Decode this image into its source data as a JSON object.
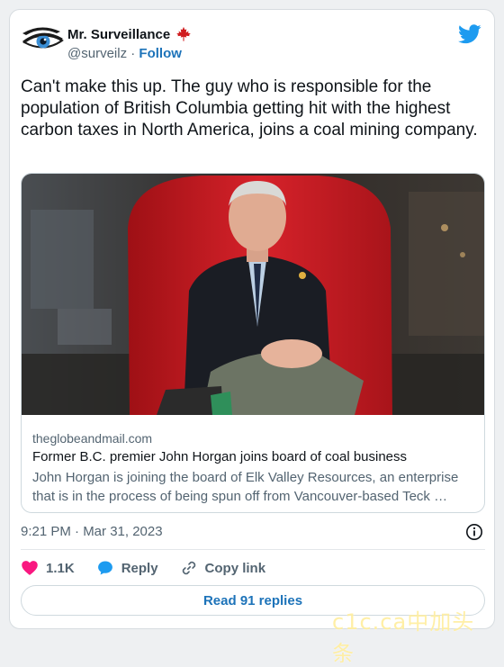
{
  "author": {
    "display_name": "Mr. Surveillance",
    "flag_icon": "maple-leaf-icon",
    "handle": "@surveilz",
    "separator": "·",
    "follow_label": "Follow"
  },
  "platform_icon": "twitter-bird-icon",
  "tweet": {
    "text": "Can't make this up. The guy who is responsible for the population of British Columbia getting hit with the highest carbon taxes in North America, joins a coal mining company."
  },
  "link_card": {
    "domain": "theglobeandmail.com",
    "title": "Former B.C. premier John Horgan joins board of coal business",
    "description": "John Horgan is joining the board of Elk Valley Resources, an enterprise that is in the process of being spun off from Vancouver-based Teck …"
  },
  "timestamp": "9:21 PM · Mar 31, 2023",
  "actions": {
    "likes": "1.1K",
    "reply_label": "Reply",
    "copy_link_label": "Copy link"
  },
  "read_replies_label": "Read 91 replies",
  "watermark": "c1c.ca中加头条",
  "colors": {
    "accent": "#1d73b9",
    "twitter_blue": "#1d9bf0",
    "heart": "#f91880",
    "maple_red": "#d01c1f",
    "text_secondary": "#536471"
  }
}
